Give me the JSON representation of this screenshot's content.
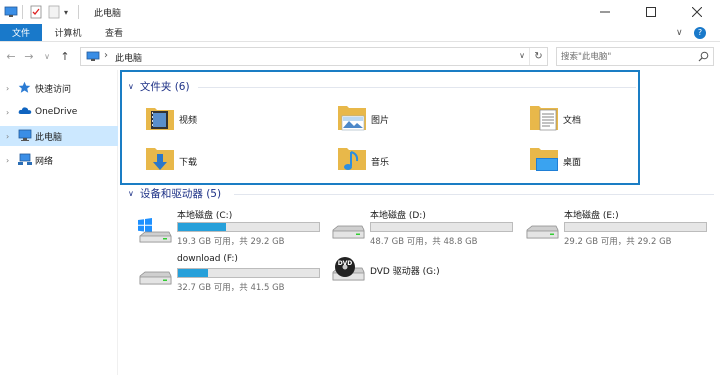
{
  "window": {
    "title": "此电脑",
    "qa_dropdown_glyph": "▾"
  },
  "ribbon": {
    "tabs": [
      "文件",
      "计算机",
      "查看"
    ],
    "expand_glyph": "∨",
    "help_glyph": "?"
  },
  "address": {
    "path_separator": "›",
    "path": "此电脑",
    "search_placeholder": "搜索\"此电脑\""
  },
  "sidebar": {
    "items": [
      {
        "label": "快速访问",
        "icon": "star-icon"
      },
      {
        "label": "OneDrive",
        "icon": "cloud-icon"
      },
      {
        "label": "此电脑",
        "icon": "computer-icon",
        "selected": true
      },
      {
        "label": "网络",
        "icon": "network-icon"
      }
    ]
  },
  "folders_group": {
    "title": "文件夹 (6)",
    "items": [
      {
        "label": "视频",
        "icon": "video-folder-icon"
      },
      {
        "label": "图片",
        "icon": "pictures-folder-icon"
      },
      {
        "label": "文档",
        "icon": "documents-folder-icon"
      },
      {
        "label": "下载",
        "icon": "downloads-folder-icon"
      },
      {
        "label": "音乐",
        "icon": "music-folder-icon"
      },
      {
        "label": "桌面",
        "icon": "desktop-folder-icon"
      }
    ]
  },
  "drives_group": {
    "title": "设备和驱动器 (5)",
    "items": [
      {
        "name": "本地磁盘 (C:)",
        "free": "19.3 GB 可用，共 29.2 GB",
        "used_fraction": 0.34,
        "icon": "windows-drive-icon"
      },
      {
        "name": "本地磁盘 (D:)",
        "free": "48.7 GB 可用，共 48.8 GB",
        "used_fraction": 0.0,
        "icon": "hard-drive-icon"
      },
      {
        "name": "本地磁盘 (E:)",
        "free": "29.2 GB 可用，共 29.2 GB",
        "used_fraction": 0.0,
        "icon": "hard-drive-icon"
      },
      {
        "name": "download (F:)",
        "free": "32.7 GB 可用，共 41.5 GB",
        "used_fraction": 0.21,
        "icon": "hard-drive-icon"
      },
      {
        "name": "DVD 驱动器 (G:)",
        "icon": "dvd-drive-icon"
      }
    ]
  },
  "colors": {
    "accent": "#1979ca",
    "highlight_border": "#1a7dc4",
    "group_header": "#1e3287",
    "selected_bg": "#cce8ff",
    "drive_fill": "#26a0da"
  }
}
